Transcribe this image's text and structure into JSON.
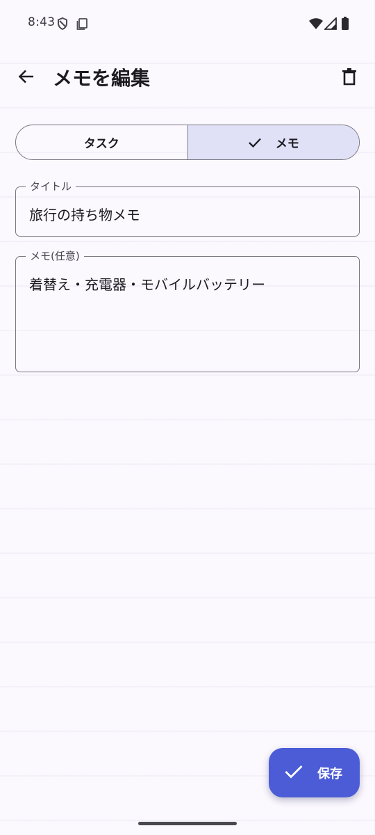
{
  "status_bar": {
    "time": "8:43",
    "icons": [
      "shield-icon",
      "clipboard-icon",
      "wifi-icon",
      "signal-icon",
      "battery-icon"
    ]
  },
  "app_bar": {
    "title": "メモを編集",
    "back_icon": "arrow-back-icon",
    "delete_icon": "trash-icon"
  },
  "type_toggle": {
    "options": [
      {
        "label": "タスク",
        "selected": false
      },
      {
        "label": "メモ",
        "selected": true
      }
    ]
  },
  "title_field": {
    "label": "タイトル",
    "value": "旅行の持ち物メモ"
  },
  "memo_field": {
    "label": "メモ(任意)",
    "value": "着替え・充電器・モバイルバッテリー"
  },
  "fab": {
    "label": "保存",
    "icon": "check-icon"
  },
  "colors": {
    "background": "#FBF8FE",
    "accent": "#4B5CD6",
    "selected_segment": "#E0E0F6",
    "outline": "#77757F"
  }
}
